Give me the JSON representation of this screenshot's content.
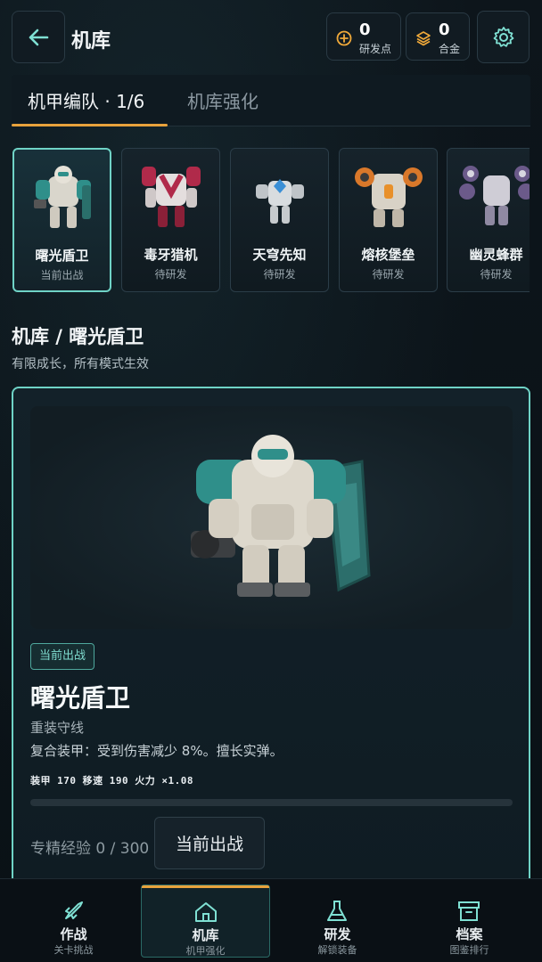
{
  "header": {
    "title": "机库",
    "research_points": {
      "value": "0",
      "label": "研发点"
    },
    "alloy": {
      "value": "0",
      "label": "合金"
    }
  },
  "tabs": [
    {
      "label": "机甲编队 · 1/6",
      "active": true
    },
    {
      "label": "机库强化",
      "active": false
    }
  ],
  "mechs": [
    {
      "name": "曙光盾卫",
      "status": "当前出战",
      "selected": true,
      "accent": "#2f8f8a"
    },
    {
      "name": "毒牙猎机",
      "status": "待研发",
      "selected": false,
      "accent": "#b02a4a"
    },
    {
      "name": "天穹先知",
      "status": "待研发",
      "selected": false,
      "accent": "#3a8fd6"
    },
    {
      "name": "熔核堡垒",
      "status": "待研发",
      "selected": false,
      "accent": "#d9782a"
    },
    {
      "name": "幽灵蜂群",
      "status": "待研发",
      "selected": false,
      "accent": "#6b5a8a"
    }
  ],
  "section": {
    "title": "机库 / 曙光盾卫",
    "subtitle": "有限成长，所有模式生效"
  },
  "detail": {
    "badge": "当前出战",
    "name": "曙光盾卫",
    "role": "重装守线",
    "description": "复合装甲：受到伤害减少 8%。擅长实弹。",
    "stats": "装甲 170  移速 190  火力 ×1.08",
    "exp_label": "专精经验 0 / 300",
    "exp_progress": 0,
    "deploy_button": "当前出战"
  },
  "nav": [
    {
      "label": "作战",
      "sub": "关卡挑战",
      "icon": "rocket-icon",
      "active": false
    },
    {
      "label": "机库",
      "sub": "机甲强化",
      "icon": "home-icon",
      "active": true
    },
    {
      "label": "研发",
      "sub": "解锁装备",
      "icon": "flask-icon",
      "active": false
    },
    {
      "label": "档案",
      "sub": "图鉴排行",
      "icon": "archive-icon",
      "active": false
    }
  ],
  "colors": {
    "accent_teal": "#6fd3c6",
    "accent_orange": "#e8a23c",
    "background": "#0b1218"
  }
}
